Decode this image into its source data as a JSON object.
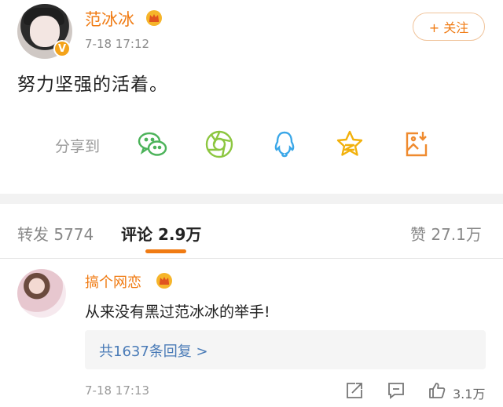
{
  "post": {
    "username": "范冰冰",
    "badge": "V",
    "time": "7-18 17:12",
    "follow_label": "+ 关注",
    "text": "努力坚强的活着。"
  },
  "share": {
    "label": "分享到",
    "targets": [
      "wechat-icon",
      "moments-icon",
      "qq-icon",
      "qzone-icon",
      "save-image-icon"
    ]
  },
  "tabs": {
    "repost": "转发 5774",
    "comments": "评论 2.9万",
    "likes": "赞 27.1万"
  },
  "comment": {
    "username": "搞个网恋",
    "text": "从来没有黑过范冰冰的举手!",
    "replies": "共1637条回复 >",
    "time": "7-18 17:13",
    "likes": "3.1万"
  },
  "colors": {
    "accent": "#f07b13",
    "link": "#4a7bb7",
    "badge": "#f4a31a"
  }
}
